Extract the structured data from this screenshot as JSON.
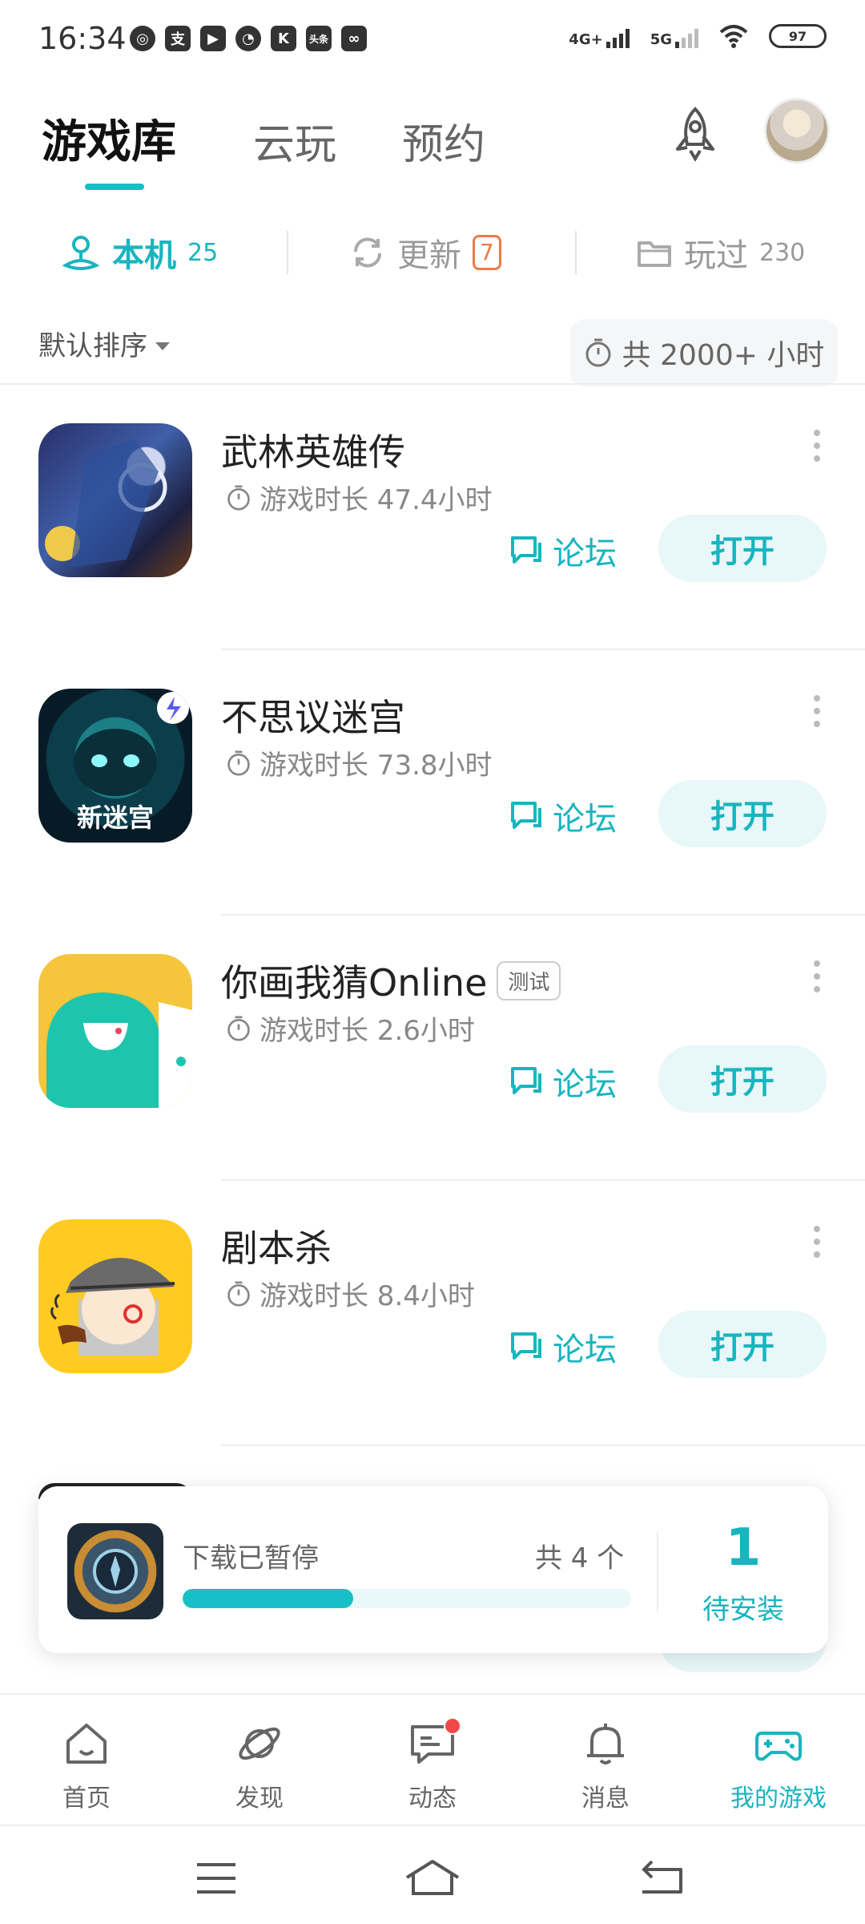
{
  "status_bar": {
    "time": "16:34",
    "left_icons": [
      "weibo-icon",
      "alipay-icon",
      "video-icon",
      "compass-icon",
      "k-app-icon",
      "toutiao-icon",
      "game-app-icon"
    ],
    "network_1": "4G+",
    "network_2": "5G",
    "battery": "97"
  },
  "header": {
    "tabs": [
      {
        "label": "游戏库",
        "active": true
      },
      {
        "label": "云玩",
        "active": false
      },
      {
        "label": "预约",
        "active": false
      }
    ]
  },
  "sub_tabs": [
    {
      "label": "本机",
      "count": "25",
      "icon": "phone-stand-icon",
      "active": true
    },
    {
      "label": "更新",
      "count": "7",
      "icon": "refresh-icon",
      "active": false
    },
    {
      "label": "玩过",
      "count": "230",
      "icon": "folder-icon",
      "active": false
    }
  ],
  "sort": {
    "label": "默认排序"
  },
  "total_time": {
    "label": "共 2000+ 小时"
  },
  "games": [
    {
      "name": "武林英雄传",
      "tag": "",
      "time": "游戏时长 47.4小时",
      "forum": "论坛",
      "open": "打开"
    },
    {
      "name": "不思议迷宫",
      "tag": "",
      "time": "游戏时长 73.8小时",
      "forum": "论坛",
      "open": "打开",
      "icon_text": "新迷宫"
    },
    {
      "name": "你画我猜Online",
      "tag": "测试",
      "time": "游戏时长 2.6小时",
      "forum": "论坛",
      "open": "打开"
    },
    {
      "name": "剧本杀",
      "tag": "",
      "time": "游戏时长 8.4小时",
      "forum": "论坛",
      "open": "打开"
    }
  ],
  "download": {
    "status": "下载已暂停",
    "count": "共 4 个",
    "progress": 0.38,
    "pending_num": "1",
    "pending_label": "待安装"
  },
  "bottom_nav": [
    {
      "label": "首页",
      "icon": "home-icon",
      "active": false
    },
    {
      "label": "发现",
      "icon": "planet-icon",
      "active": false
    },
    {
      "label": "动态",
      "icon": "chat-icon",
      "active": false,
      "dot": true
    },
    {
      "label": "消息",
      "icon": "bell-icon",
      "active": false
    },
    {
      "label": "我的游戏",
      "icon": "gamepad-icon",
      "active": true
    }
  ],
  "colors": {
    "accent": "#17b5bf",
    "update_badge": "#ef7a45",
    "notification_dot": "#f04848"
  }
}
